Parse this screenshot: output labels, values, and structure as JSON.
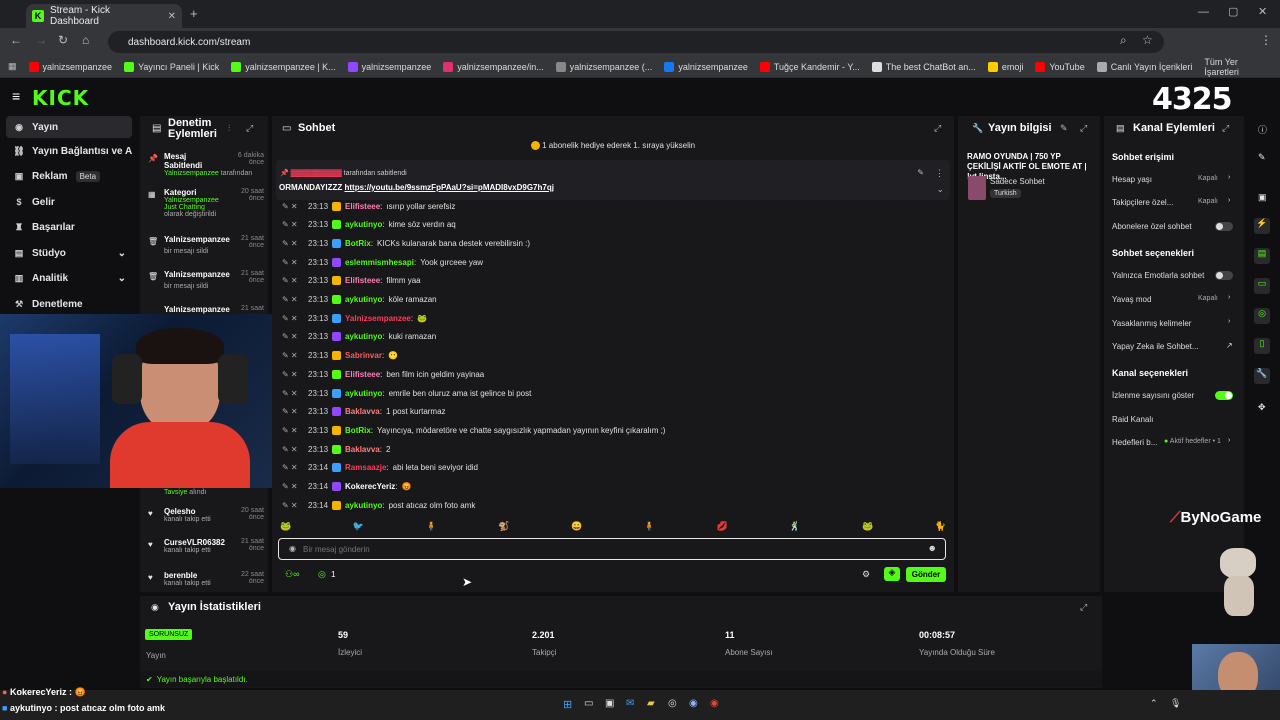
{
  "browser": {
    "tab_title": "Stream - Kick Dashboard",
    "url": "dashboard.kick.com/stream",
    "bookmarks": [
      {
        "label": "yalnizsempanzee",
        "color": "#ff0000"
      },
      {
        "label": "Yayıncı Paneli | Kick",
        "color": "#53fc18"
      },
      {
        "label": "yalnizsempanzee | K...",
        "color": "#53fc18"
      },
      {
        "label": "yalnizsempanzee",
        "color": "#9146ff"
      },
      {
        "label": "yalnizsempanzee/in...",
        "color": "#e1306c"
      },
      {
        "label": "yalnizsempanzee (...",
        "color": "#888888"
      },
      {
        "label": "yalnizsempanzee",
        "color": "#1877f2"
      },
      {
        "label": "Tuğçe Kandemir - Y...",
        "color": "#ff0000"
      },
      {
        "label": "The best ChatBot an...",
        "color": "#dddddd"
      },
      {
        "label": "emoji",
        "color": "#ffcc00"
      },
      {
        "label": "YouTube",
        "color": "#ff0000"
      },
      {
        "label": "Canlı Yayın İçerikleri",
        "color": "#aaaaaa"
      }
    ],
    "all_bookmarks": "Tüm Yer İşaretleri"
  },
  "kick": {
    "logo": "KICK",
    "overlay_number": "4325"
  },
  "nav": {
    "items": [
      {
        "label": "Yayın"
      },
      {
        "label": "Yayın Bağlantısı ve Anahtarı"
      },
      {
        "label": "Reklam"
      },
      {
        "label": "Gelir"
      },
      {
        "label": "Başarılar"
      },
      {
        "label": "Stüdyo"
      },
      {
        "label": "Analitik"
      },
      {
        "label": "Denetleme"
      }
    ],
    "beta": "Beta"
  },
  "moderation": {
    "title_line1": "Denetim",
    "title_line2": "Eylemleri",
    "rows": [
      {
        "title": "Mesaj Sabitlendi",
        "sub1": "Yalnizsempanzee",
        "sub2": "tarafından",
        "time": "6 dakika önce"
      },
      {
        "title": "Kategori",
        "sub1": "Yalnizsempanzee Just Chatting",
        "sub2": "olarak değiştirildi",
        "time": "20 saat önce"
      },
      {
        "title": "Yalnizsempanzee",
        "sub1": "bir mesajı sildi",
        "sub2": "",
        "time": "21 saat önce"
      },
      {
        "title": "Yalnizsempanzee",
        "sub1": "bir mesajı sildi",
        "sub2": "",
        "time": "21 saat önce"
      },
      {
        "title": "Yalnizsempanzee",
        "sub1": "",
        "sub2": "",
        "time": "21 saat"
      }
    ],
    "lower_rows": [
      {
        "title": "Tavsiye",
        "sub": "alındı",
        "time": ""
      },
      {
        "title": "Qelesho",
        "sub": "kanalı takip etti",
        "time": "20 saat önce"
      },
      {
        "title": "CurseVLR06382",
        "sub": "kanalı takip etti",
        "time": "21 saat önce"
      },
      {
        "title": "berenble",
        "sub": "kanalı takip etti",
        "time": "22 saat önce"
      }
    ]
  },
  "chat": {
    "title": "Sohbet",
    "banner": "1 abonelik hediye ederek 1. sıraya yükselin",
    "pinned_by": "tarafından sabitlendi",
    "pinned_text": "ORMANDAYIZZZ",
    "pinned_link": "https://youtu.be/9ssmzFpPAaU?si=pMADI8vxD9G7h7qj",
    "messages": [
      {
        "time": "23:13",
        "user": "Elifisteee",
        "color": "#ff7eb6",
        "text": "ısırıp yollar serefsiz"
      },
      {
        "time": "23:13",
        "user": "aykutinyo",
        "color": "#53fc18",
        "text": "kime söz verdın aq"
      },
      {
        "time": "23:13",
        "user": "BotRix",
        "color": "#53fc18",
        "text": "KICKs kulanarak bana destek verebilirsin :)"
      },
      {
        "time": "23:13",
        "user": "eslemmismhesapi",
        "color": "#53fc18",
        "text": "Yook gırceee yaw"
      },
      {
        "time": "23:13",
        "user": "Elifisteee",
        "color": "#ff7eb6",
        "text": "filmm yaa"
      },
      {
        "time": "23:13",
        "user": "aykutinyo",
        "color": "#53fc18",
        "text": "köle ramazan"
      },
      {
        "time": "23:13",
        "user": "Yalnizsempanzee",
        "color": "#ff3b5c",
        "text": "🐸"
      },
      {
        "time": "23:13",
        "user": "aykutinyo",
        "color": "#53fc18",
        "text": "kuki ramazan"
      },
      {
        "time": "23:13",
        "user": "Sabrinvar",
        "color": "#ff5a5a",
        "text": "😶"
      },
      {
        "time": "23:13",
        "user": "Elifisteee",
        "color": "#ff7eb6",
        "text": "ben film icin geldim yayinaa"
      },
      {
        "time": "23:13",
        "user": "aykutinyo",
        "color": "#53fc18",
        "text": "emrile ben oluruz ama ist gelince bi post"
      },
      {
        "time": "23:13",
        "user": "Baklavva",
        "color": "#ff7e7e",
        "text": "1 post kurtarmaz"
      },
      {
        "time": "23:13",
        "user": "BotRix",
        "color": "#53fc18",
        "text": "Yayıncıya, mödaretöre ve chatte saygısızlık yapmadan yayının keyfini çıkaralım ;)"
      },
      {
        "time": "23:13",
        "user": "Baklavva",
        "color": "#ff7e7e",
        "text": "2"
      },
      {
        "time": "23:14",
        "user": "Ramsaazje",
        "color": "#ff3b5c",
        "text": "abi leta beni seviyor idid"
      },
      {
        "time": "23:14",
        "user": "KokerecYeriz",
        "color": "#ffffff",
        "text": "😡"
      },
      {
        "time": "23:14",
        "user": "aykutinyo",
        "color": "#53fc18",
        "text": "post atıcaz olm foto amk"
      }
    ],
    "placeholder": "Bir mesaj gönderin",
    "send": "Gönder",
    "count": "1"
  },
  "stream_info": {
    "title": "Yayın bilgisi",
    "stream_title": "RAMO OYUNDA | 750 YP ÇEKİLİŞİ AKTİF OL EMOTE AT | !yt linsta...",
    "category": "Sadece Sohbet",
    "language": "Turkish"
  },
  "channel_actions": {
    "title": "Kanal Eylemleri",
    "chat_access": "Sohbet erişimi",
    "account_age": "Hesap yaşı",
    "account_age_val": "Kapalı",
    "followers": "Takipçilere özel...",
    "followers_val": "Kapalı",
    "subs_only": "Abonelere özel sohbet",
    "chat_options": "Sohbet seçenekleri",
    "emotes_only": "Yalnızca Emotlarla sohbet",
    "slow_mode": "Yavaş mod",
    "slow_mode_val": "Kapalı",
    "banned_words": "Yasaklanmış kelimeler",
    "ai_chat": "Yapay Zeka ile Sohbet...",
    "channel_options": "Kanal seçenekleri",
    "show_viewers": "İzlenme sayısını göster",
    "raid": "Raid Kanalı",
    "goals": "Hedefleri b...",
    "goals_val": "Aktif hedefler • 1"
  },
  "stats": {
    "title": "Yayın İstatistikleri",
    "status_badge": "SORUNSUZ",
    "status_label": "Yayın",
    "viewers": "59",
    "viewers_label": "İzleyici",
    "followers": "2.201",
    "followers_label": "Takipçi",
    "subs": "11",
    "subs_label": "Abone Sayısı",
    "duration": "00:08:57",
    "duration_label": "Yayında Olduğu Süre",
    "success": "Yayın başarıyla başlatıldı."
  },
  "overlay": {
    "brand": "ByNoGame",
    "bottom_chat": [
      {
        "user": "KokerecYeriz :",
        "text": "😡"
      },
      {
        "user": "aykutinyo :",
        "text": "post atıcaz olm foto amk"
      }
    ]
  }
}
